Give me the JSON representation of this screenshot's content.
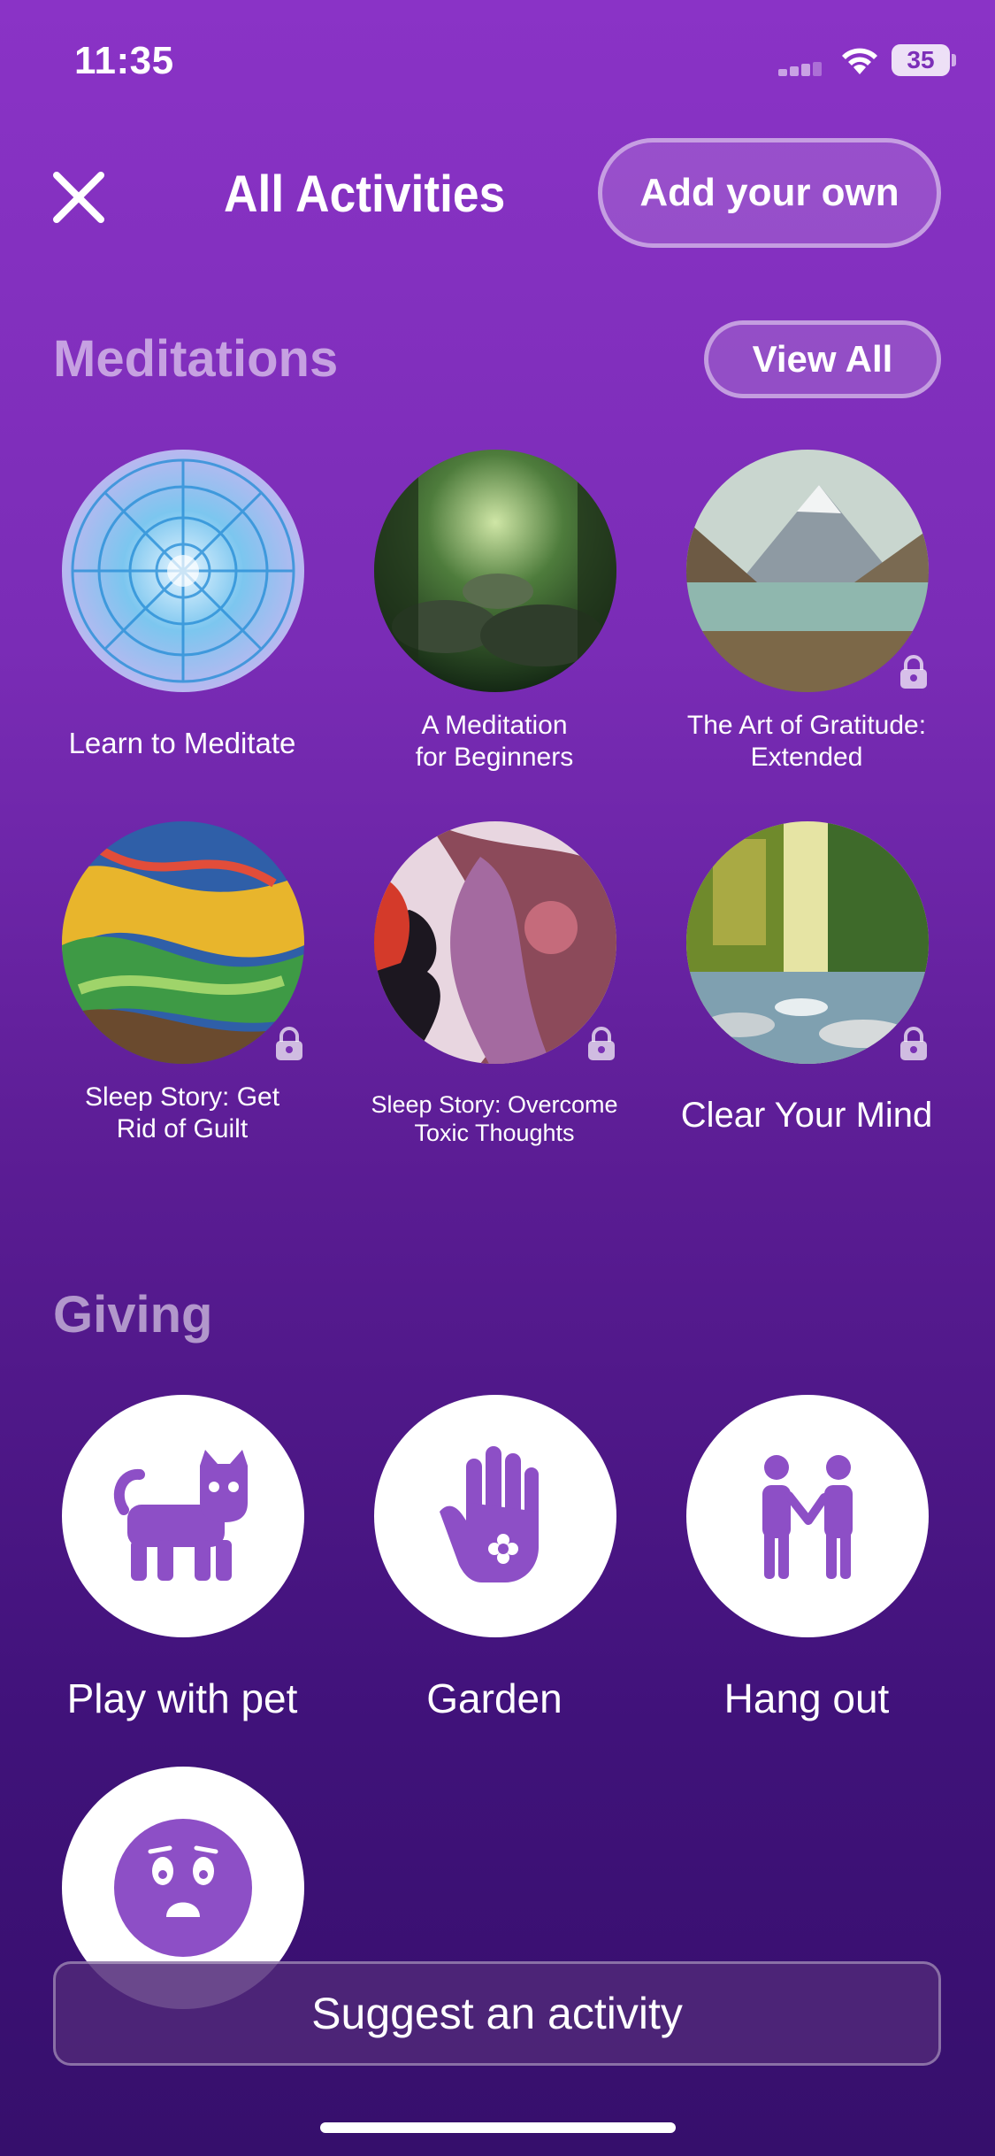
{
  "status": {
    "time": "11:35",
    "battery": "35"
  },
  "header": {
    "title": "All Activities",
    "add_label": "Add your own"
  },
  "meditations": {
    "title": "Meditations",
    "view_all": "View All",
    "items": [
      {
        "line1": "Learn to Meditate",
        "line2": "",
        "locked": false,
        "image": "mandala"
      },
      {
        "line1": "A Meditation",
        "line2": "for Beginners",
        "locked": false,
        "image": "forest"
      },
      {
        "line1": "The Art of Gratitude:",
        "line2": "Extended",
        "locked": true,
        "image": "mountain-lake"
      },
      {
        "line1": "Sleep Story: Get",
        "line2": "Rid of Guilt",
        "locked": true,
        "image": "abstract-swirl"
      },
      {
        "line1": "Sleep Story: Overcome",
        "line2": "Toxic Thoughts",
        "locked": true,
        "image": "face-silhouettes"
      },
      {
        "line1": "Clear Your Mind",
        "line2": "",
        "locked": true,
        "image": "river-trees"
      }
    ]
  },
  "giving": {
    "title": "Giving",
    "items": [
      {
        "label": "Play with pet",
        "icon": "cat-icon"
      },
      {
        "label": "Garden",
        "icon": "hand-flower-icon"
      },
      {
        "label": "Hang out",
        "icon": "two-people-icon"
      },
      {
        "label": "",
        "icon": "surprised-face-icon"
      }
    ]
  },
  "footer": {
    "suggest_label": "Suggest an activity"
  },
  "colors": {
    "accent": "#8d4fc6",
    "background_top": "#8a33c6",
    "background_bottom": "#360f6c"
  }
}
